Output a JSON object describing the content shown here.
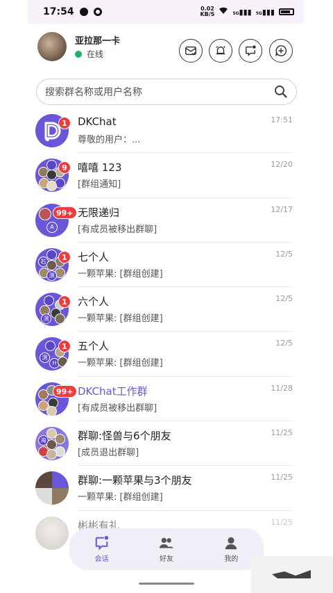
{
  "status_bar": {
    "time": "17:54",
    "net_speed": "0.02",
    "net_unit": "KB/S",
    "signal_1": "5G",
    "signal_2": "5G"
  },
  "header": {
    "username": "亚拉那一卡",
    "status": "在线",
    "buttons": [
      {
        "name": "mail-check-button",
        "icon": "mail-check-icon"
      },
      {
        "name": "alarm-button",
        "icon": "alarm-bell-icon"
      },
      {
        "name": "notice-message-button",
        "icon": "chat-dot-icon"
      },
      {
        "name": "add-chat-button",
        "icon": "chat-plus-icon"
      }
    ]
  },
  "search": {
    "placeholder": "搜索群名称或用户名称"
  },
  "conversations": [
    {
      "name": "DKChat",
      "preview": "尊敬的用户：...",
      "time": "17:51",
      "badge": "1",
      "accent": false
    },
    {
      "name": "嘻嘻 123",
      "preview": "[群组通知]",
      "time": "12/20",
      "badge": "9",
      "accent": false
    },
    {
      "name": "无限递归",
      "preview": "[有成员被移出群聊]",
      "time": "12/17",
      "badge": "99+",
      "accent": false
    },
    {
      "name": "七个人",
      "preview": "一颗苹果: [群组创建]",
      "time": "12/5",
      "badge": "1",
      "accent": false
    },
    {
      "name": "六个人",
      "preview": "一颗苹果: [群组创建]",
      "time": "12/5",
      "badge": "1",
      "accent": false
    },
    {
      "name": "五个人",
      "preview": "一颗苹果: [群组创建]",
      "time": "12/5",
      "badge": "1",
      "accent": false
    },
    {
      "name": "DKChat工作群",
      "preview": "[有成员被移出群聊]",
      "time": "11/28",
      "badge": "99+",
      "accent": true
    },
    {
      "name": "群聊:怪兽与6个朋友",
      "preview": "[成员退出群聊]",
      "time": "11/25",
      "badge": "",
      "accent": false
    },
    {
      "name": "群聊:一颗苹果与3个朋友",
      "preview": "一颗苹果: [群组创建]",
      "time": "11/25",
      "badge": "",
      "accent": false
    },
    {
      "name": "彬彬有礼",
      "preview": "",
      "time": "11/25",
      "badge": "",
      "accent": false
    }
  ],
  "avatar_letters": {
    "row3": "A",
    "row4a": "石",
    "row4b": "测",
    "row5": "测",
    "row6a": "测",
    "row6b": "H",
    "row8": "海"
  },
  "tabs": [
    {
      "label": "会话",
      "icon": "chat-icon",
      "active": true
    },
    {
      "label": "好友",
      "icon": "friends-icon",
      "active": false
    },
    {
      "label": "我的",
      "icon": "profile-icon",
      "active": false
    }
  ],
  "colors": {
    "accent": "#6b55d8",
    "badge": "#ee3b3b",
    "online": "#19b36b"
  }
}
